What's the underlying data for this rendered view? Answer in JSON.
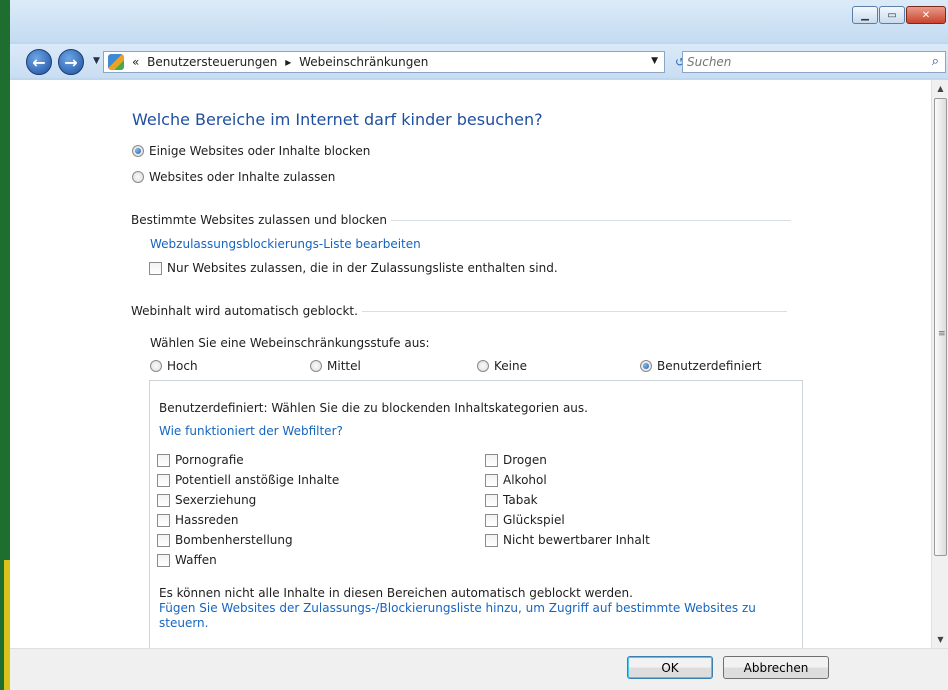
{
  "window": {
    "minimize": "▁",
    "maximize": "▭",
    "close": "✕"
  },
  "nav": {
    "back_icon": "back-arrow-icon",
    "forward_icon": "forward-arrow-icon",
    "back": "←",
    "forward": "→",
    "history_dropdown": "▼",
    "breadcrumb_prefix": "«",
    "breadcrumb": [
      "Benutzersteuerungen",
      "Webeinschränkungen"
    ],
    "breadcrumb_sep": "▸",
    "address_dropdown": "▼",
    "refresh": "↺",
    "search_placeholder": "Suchen",
    "search_icon": "⌕"
  },
  "main": {
    "title": "Welche Bereiche im Internet darf kinder besuchen?",
    "mode_options": [
      {
        "label": "Einige Websites oder Inhalte blocken",
        "selected": true
      },
      {
        "label": "Websites oder Inhalte zulassen",
        "selected": false
      }
    ],
    "section1": {
      "heading": "Bestimmte Websites zulassen und blocken",
      "link": "Webzulassungsblockierungs-Liste bearbeiten",
      "checkbox": "Nur Websites zulassen, die in der Zulassungsliste enthalten sind."
    },
    "section2": {
      "heading": "Webinhalt wird automatisch geblockt.",
      "level_prompt": "Wählen Sie eine Webeinschränkungsstufe aus:",
      "levels": [
        {
          "label": "Hoch",
          "selected": false
        },
        {
          "label": "Mittel",
          "selected": false
        },
        {
          "label": "Keine",
          "selected": false
        },
        {
          "label": "Benutzerdefiniert",
          "selected": true
        }
      ]
    },
    "custom": {
      "intro": "Benutzerdefiniert: Wählen Sie die zu blockenden Inhaltskategorien aus.",
      "help_link": "Wie funktioniert der Webfilter?",
      "categories_left": [
        "Pornografie",
        "Potentiell anstößige Inhalte",
        "Sexerziehung",
        "Hassreden",
        "Bombenherstellung",
        "Waffen"
      ],
      "categories_right": [
        "Drogen",
        "Alkohol",
        "Tabak",
        "Glückspiel",
        "Nicht bewertbarer Inhalt"
      ],
      "note": "Es können nicht alle Inhalte in diesen Bereichen automatisch geblockt werden.",
      "note_link": "Fügen Sie Websites der Zulassungs-/Blockierungsliste hinzu, um Zugriff auf bestimmte Websites zu steuern."
    }
  },
  "footer": {
    "ok": "OK",
    "cancel": "Abbrechen"
  },
  "scrollbar": {
    "up": "▲",
    "down": "▼",
    "grip": "≡"
  }
}
